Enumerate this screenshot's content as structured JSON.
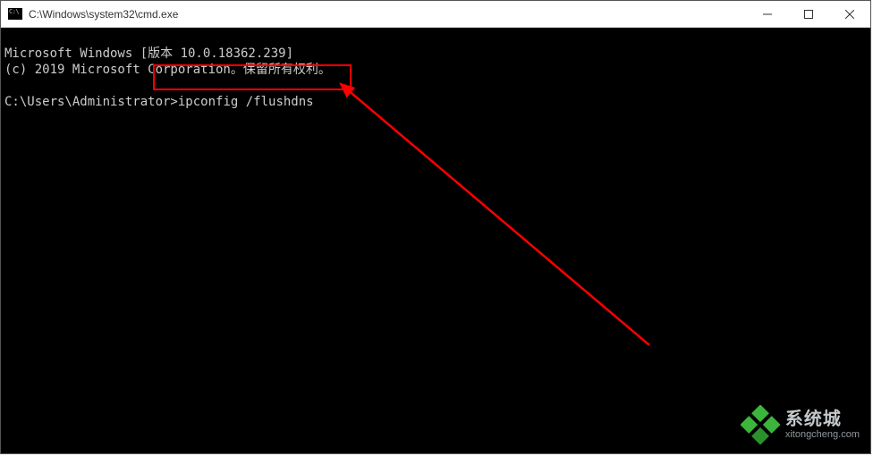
{
  "window": {
    "title": "C:\\Windows\\system32\\cmd.exe"
  },
  "console": {
    "line1": "Microsoft Windows [版本 10.0.18362.239]",
    "line2": "(c) 2019 Microsoft Corporation。保留所有权利。",
    "prompt": "C:\\Users\\Administrator>",
    "command": "ipconfig /flushdns"
  },
  "annotation": {
    "highlight_color": "#ff0000"
  },
  "watermark": {
    "title": "系统城",
    "subtitle": "xitongcheng.com",
    "accent_color": "#3fbf3f"
  }
}
